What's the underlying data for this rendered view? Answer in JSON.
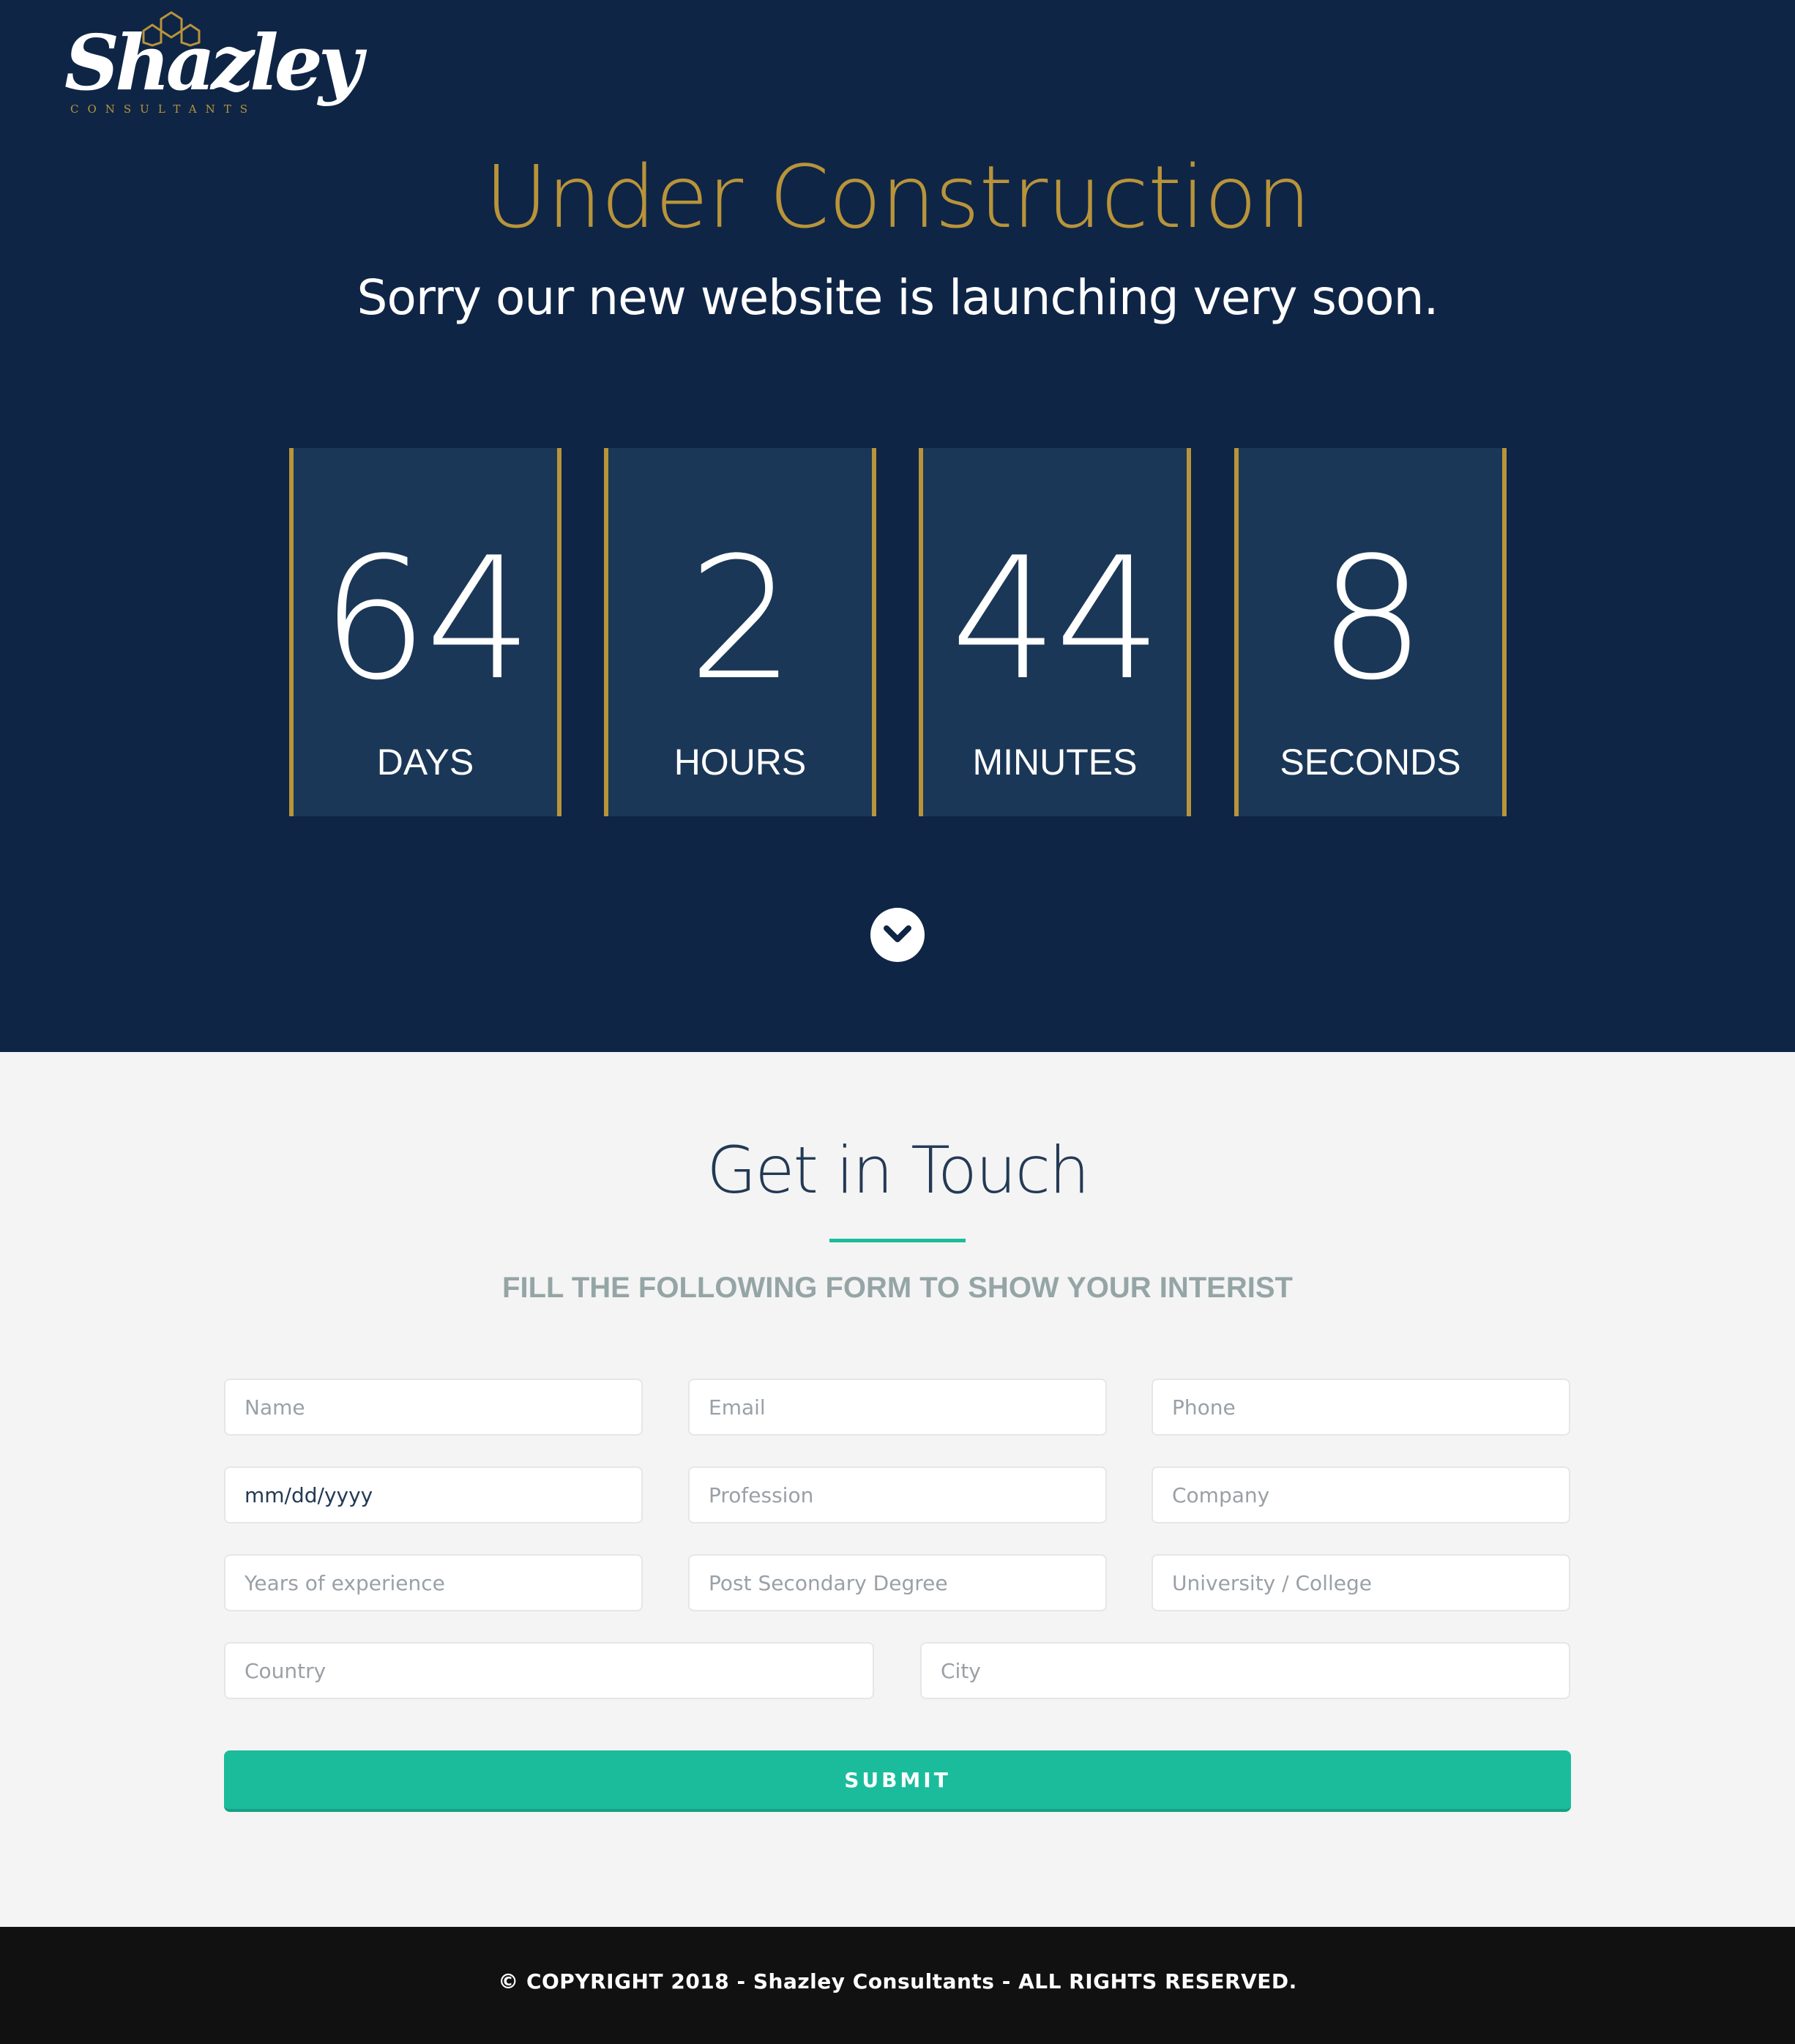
{
  "brand": {
    "logo_text": "Shazley",
    "logo_subtext": "CONSULTANTS",
    "accent_color": "#b8943a",
    "hero_bg": "#0f2546"
  },
  "hero": {
    "title": "Under Construction",
    "subtitle": "Sorry our new website is launching very soon."
  },
  "countdown": [
    {
      "value": "64",
      "label": "DAYS"
    },
    {
      "value": "2",
      "label": "HOURS"
    },
    {
      "value": "44",
      "label": "MINUTES"
    },
    {
      "value": "8",
      "label": "SECONDS"
    }
  ],
  "scroll_icon": "chevron-down-circle-icon",
  "contact": {
    "title": "Get in Touch",
    "subtitle": "FILL THE FOLLOWING FORM TO SHOW YOUR INTERIST",
    "fields": {
      "name": "Name",
      "email": "Email",
      "phone": "Phone",
      "date": "mm/dd/yyyy",
      "profession": "Profession",
      "company": "Company",
      "experience": "Years of experience",
      "degree": "Post Secondary Degree",
      "university": "University / College",
      "country": "Country",
      "city": "City"
    },
    "submit_label": "SUBMIT",
    "button_color": "#1abc9c"
  },
  "footer": {
    "copyright": "© COPYRIGHT 2018 - Shazley Consultants - ALL RIGHTS RESERVED."
  }
}
